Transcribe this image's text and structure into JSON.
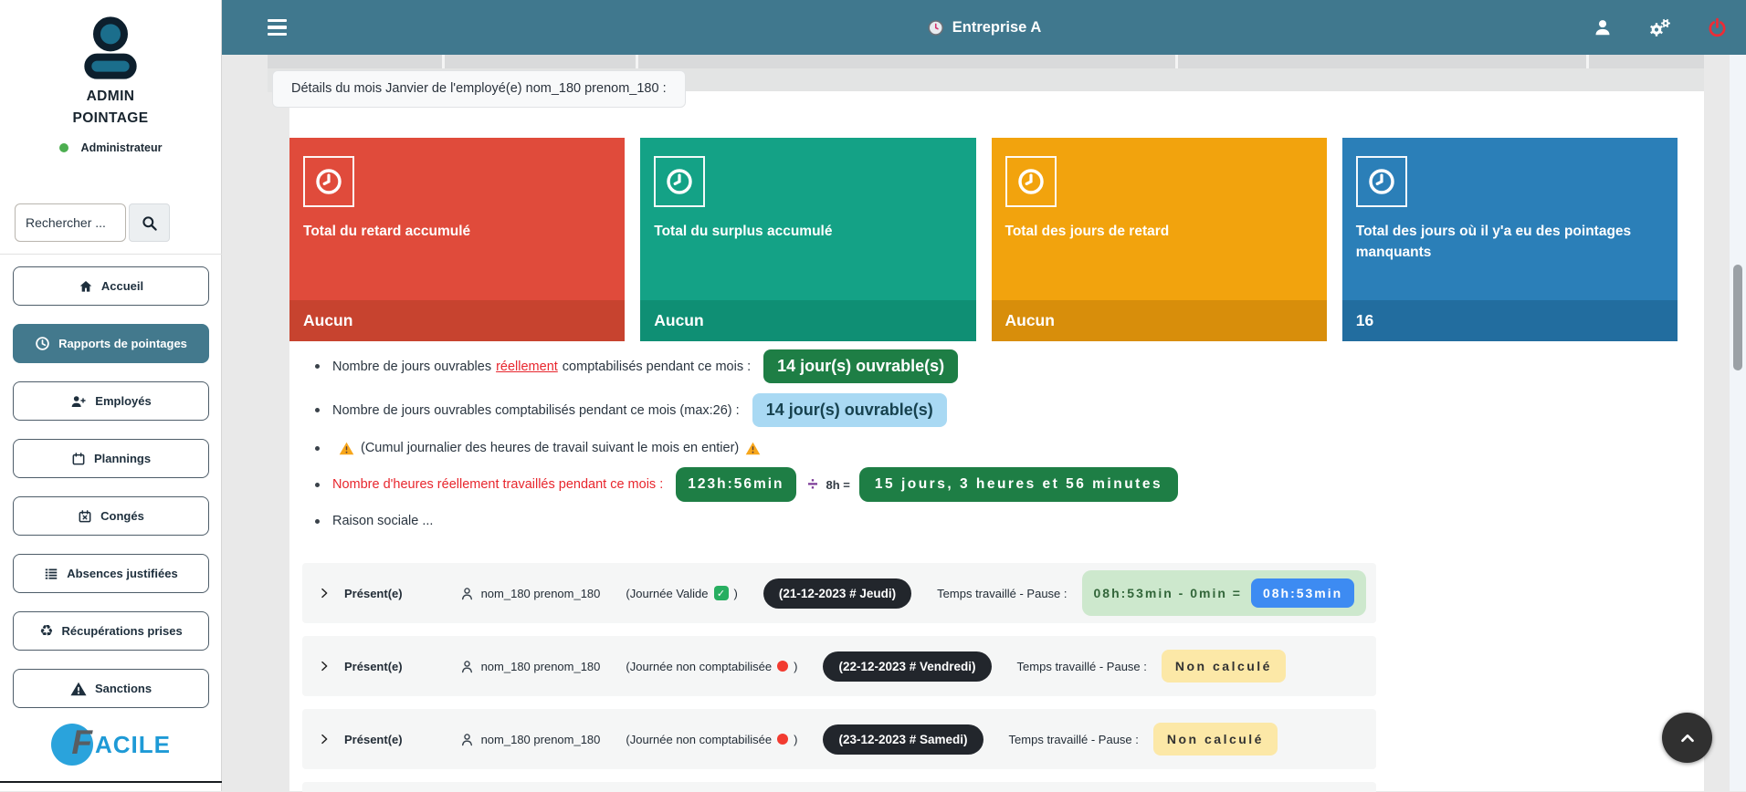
{
  "header": {
    "company": "Entreprise A",
    "icons": {
      "clock": "clock-emoji-icon",
      "user": "user-icon",
      "settings": "gears-icon",
      "logout": "power-icon"
    }
  },
  "sidebar": {
    "user": {
      "line1": "ADMIN",
      "line2": "POINTAGE",
      "role": "Administrateur"
    },
    "search": {
      "placeholder": "Rechercher ..."
    },
    "items": [
      {
        "label": "Accueil",
        "icon": "home-icon",
        "active": false
      },
      {
        "label": "Rapports de pointages",
        "icon": "clock-icon",
        "active": true
      },
      {
        "label": "Employés",
        "icon": "user-plus-icon",
        "active": false
      },
      {
        "label": "Plannings",
        "icon": "calendar-icon",
        "active": false
      },
      {
        "label": "Congés",
        "icon": "calendar-x-icon",
        "active": false
      },
      {
        "label": "Absences justifiées",
        "icon": "list-icon",
        "active": false
      },
      {
        "label": "Récupérations prises",
        "icon": "recycle-icon",
        "active": false
      },
      {
        "label": "Sanctions",
        "icon": "warning-icon",
        "active": false
      }
    ],
    "logo": {
      "letter": "F",
      "rest": "ACILE"
    }
  },
  "page": {
    "details_banner": "Détails du mois Janvier de l'employé(e) nom_180 prenom_180 :"
  },
  "cards": [
    {
      "title": "Total du retard accumulé",
      "value": "Aucun",
      "bg": "#e04b3b",
      "footer_bg": "#c7432f"
    },
    {
      "title": "Total du surplus accumulé",
      "value": "Aucun",
      "bg": "#14a286",
      "footer_bg": "#0f8f74"
    },
    {
      "title": "Total des jours de retard",
      "value": "Aucun",
      "bg": "#f2a30d",
      "footer_bg": "#d88e0b"
    },
    {
      "title": "Total des jours où il y'a eu des pointages manquants",
      "value": "16",
      "bg": "#2b7fb8",
      "footer_bg": "#226d9f"
    }
  ],
  "summary": {
    "b1": {
      "pre": "Nombre de jours ouvrables",
      "link": "réellement",
      "post": "comptabilisés pendant ce mois :",
      "badge": "14 jour(s) ouvrable(s)"
    },
    "b2": {
      "text": "Nombre de jours ouvrables comptabilisés pendant ce mois (max:26) :",
      "badge": "14 jour(s) ouvrable(s)"
    },
    "b3": {
      "text": "(Cumul journalier des heures de travail suivant le mois en entier)"
    },
    "b4": {
      "label": "Nombre d'heures réellement travaillés pendant ce mois :",
      "hours": "123h:56min",
      "op": "÷",
      "rhs": "8h =",
      "result": "15 jours, 3 heures et 56 minutes"
    },
    "b5": {
      "text": "Raison sociale ..."
    }
  },
  "rows": [
    {
      "status": "Présent(e)",
      "name": "nom_180 prenom_180",
      "day": "(Journée Valide",
      "day_close": ")",
      "indicator": "check",
      "date": "(21-12-2023 # Jeudi)",
      "time_label": "Temps travaillé - Pause :",
      "calc": "08h:53min - 0min =",
      "result": "08h:53min"
    },
    {
      "status": "Présent(e)",
      "name": "nom_180 prenom_180",
      "day": "(Journée non comptabilisée",
      "day_close": ")",
      "indicator": "red-dot",
      "date": "(22-12-2023 # Vendredi)",
      "time_label": "Temps travaillé - Pause :",
      "value": "Non calculé"
    },
    {
      "status": "Présent(e)",
      "name": "nom_180 prenom_180",
      "day": "(Journée non comptabilisée",
      "day_close": ")",
      "indicator": "red-dot",
      "date": "(23-12-2023 # Samedi)",
      "time_label": "Temps travaillé - Pause :",
      "value": "Non calculé"
    }
  ],
  "icons": {
    "check": "✓",
    "recycle": "♻"
  },
  "colors": {
    "header_teal": "#40788e",
    "badge_green": "#1e7e45",
    "badge_light_blue": "#a9d9f3",
    "result_blue": "#3d8bf2",
    "pill_yellow": "#fce8a7",
    "pill_light_green": "#cde8cd",
    "danger_red": "#e8262d",
    "divide_purple": "#7d3c98"
  }
}
